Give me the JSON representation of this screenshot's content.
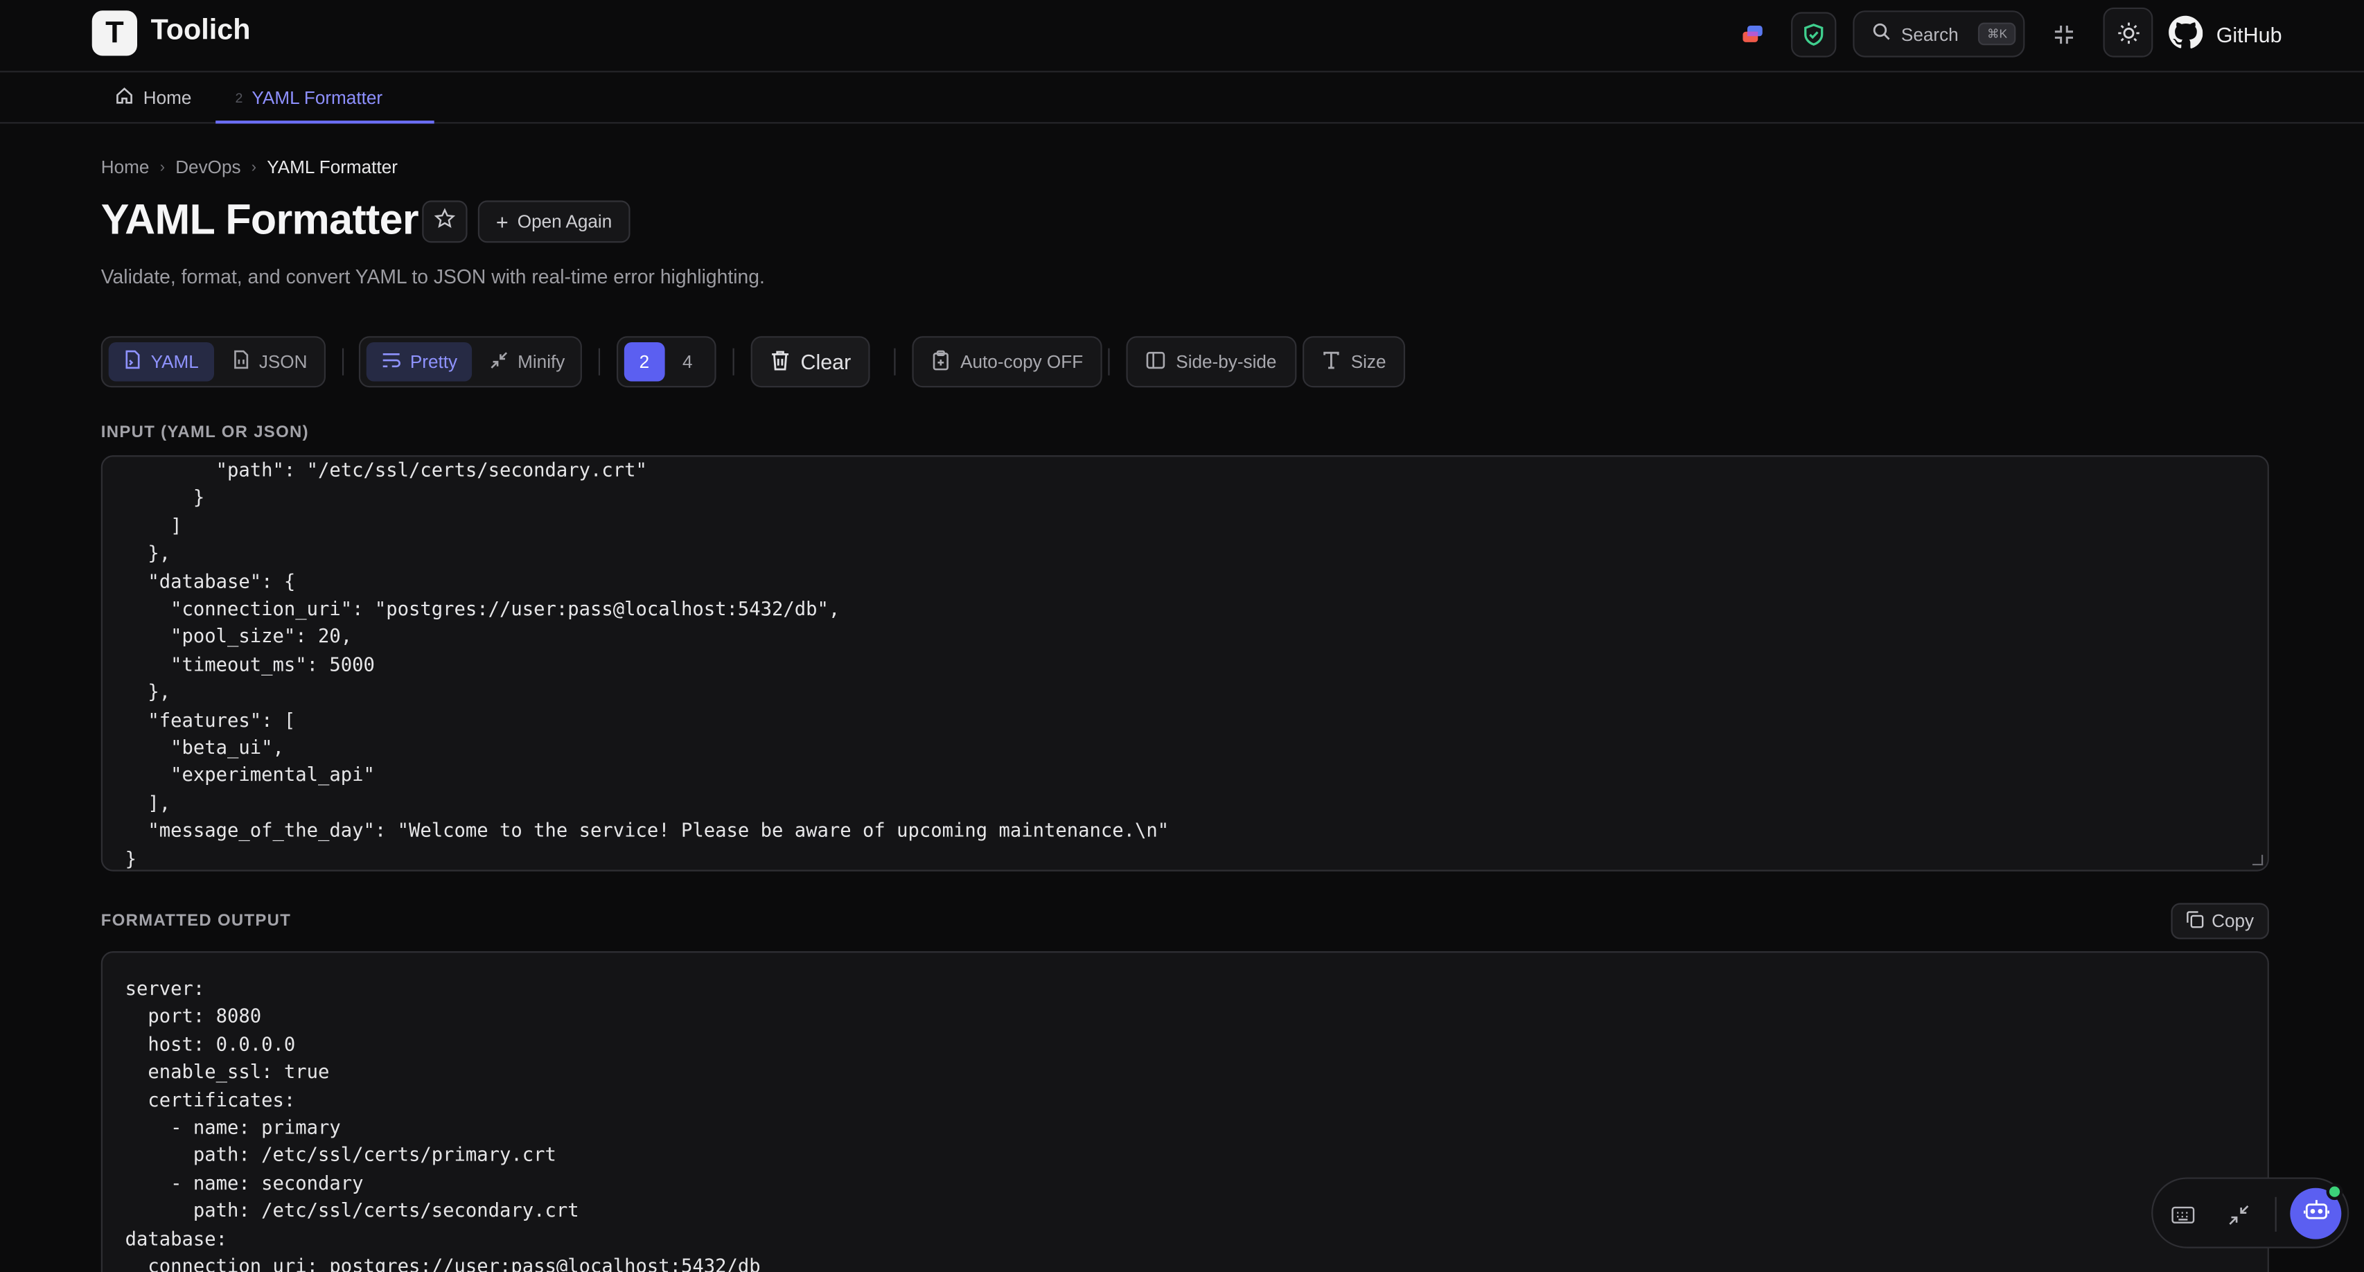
{
  "app": {
    "brand": "Toolich",
    "logo_letter": "T"
  },
  "header": {
    "search_label": "Search",
    "search_shortcut": "⌘K",
    "github_label": "GitHub",
    "icons": [
      "stack-icon",
      "shield-check-icon",
      "search-icon",
      "minimize-icon",
      "sun-icon",
      "github-icon"
    ]
  },
  "tabs": {
    "home_label": "Home",
    "active_index": "2",
    "active_label": "YAML Formatter"
  },
  "breadcrumb": [
    "Home",
    "DevOps",
    "YAML Formatter"
  ],
  "page": {
    "title": "YAML Formatter",
    "open_again": "Open Again",
    "subtitle": "Validate, format, and convert YAML to JSON with real-time error highlighting."
  },
  "toolbar": {
    "yaml": "YAML",
    "json": "JSON",
    "pretty": "Pretty",
    "minify": "Minify",
    "indent_2": "2",
    "indent_4": "4",
    "clear": "Clear",
    "autocopy": "Auto-copy OFF",
    "side_by_side": "Side-by-side",
    "size": "Size"
  },
  "input": {
    "label": "INPUT (YAML OR JSON)",
    "visible_text": "        \"path\": \"/etc/ssl/certs/secondary.crt\"\n      }\n    ]\n  },\n  \"database\": {\n    \"connection_uri\": \"postgres://user:pass@localhost:5432/db\",\n    \"pool_size\": 20,\n    \"timeout_ms\": 5000\n  },\n  \"features\": [\n    \"beta_ui\",\n    \"experimental_api\"\n  ],\n  \"message_of_the_day\": \"Welcome to the service! Please be aware of upcoming maintenance.\\n\"\n}"
  },
  "output": {
    "label": "FORMATTED OUTPUT",
    "copy": "Copy",
    "visible_text": "server:\n  port: 8080\n  host: 0.0.0.0\n  enable_ssl: true\n  certificates:\n    - name: primary\n      path: /etc/ssl/certs/primary.crt\n    - name: secondary\n      path: /etc/ssl/certs/secondary.crt\ndatabase:\n  connection_uri: postgres://user:pass@localhost:5432/db"
  },
  "colors": {
    "background": "#0b0b0c",
    "accent": "#6b6ef5",
    "accent_fill": "#5b5ff1",
    "status_online": "#3cd27a"
  }
}
